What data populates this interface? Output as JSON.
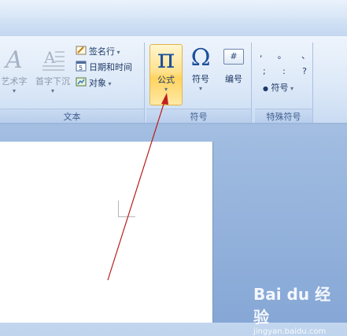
{
  "ribbon": {
    "text_group": {
      "label": "文本",
      "wordart_label": "艺术字",
      "dropcap_label": "首字下沉",
      "signature_label": "签名行",
      "datetime_label": "日期和时间",
      "object_label": "对象"
    },
    "symbol_group": {
      "label": "符号",
      "formula_label": "公式",
      "symbol_label": "符号",
      "number_label": "编号",
      "number_glyph": "#",
      "pi_glyph": "π",
      "omega_glyph": "Ω"
    },
    "special_group": {
      "label": "特殊符号",
      "row1": [
        ",",
        "。",
        "、"
      ],
      "row2": [
        ";",
        ":",
        "?"
      ],
      "symbol_label": "符号",
      "bullet_glyph": "●"
    }
  },
  "watermark": {
    "logo": "Bai du 经验",
    "url": "jingyan.baidu.com"
  }
}
